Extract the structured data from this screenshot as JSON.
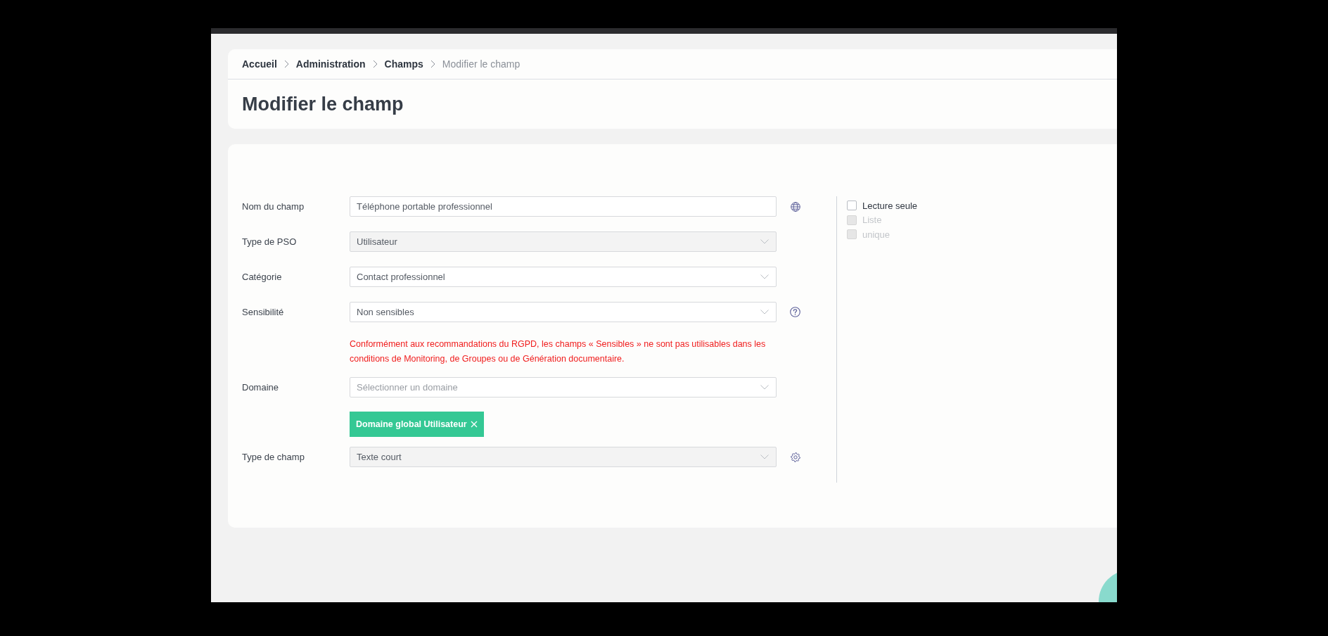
{
  "breadcrumb": [
    {
      "label": "Accueil",
      "current": false
    },
    {
      "label": "Administration",
      "current": false
    },
    {
      "label": "Champs",
      "current": false
    },
    {
      "label": "Modifier le champ",
      "current": true
    }
  ],
  "title": "Modifier le champ",
  "form": {
    "fields": [
      {
        "label": "Nom du champ",
        "kind": "text",
        "value": "Téléphone portable professionnel",
        "disabled": false,
        "side_button": {
          "kind": "translate"
        }
      },
      {
        "label": "Type de PSO",
        "kind": "select",
        "value": "Utilisateur",
        "disabled": true
      },
      {
        "label": "Catégorie",
        "kind": "select",
        "value": "Contact professionnel",
        "disabled": false
      },
      {
        "label": "Sensibilité",
        "kind": "select",
        "value": "Non sensibles",
        "disabled": false,
        "side_button": {
          "kind": "help"
        },
        "note": "Conformément aux recommandations du RGPD, les champs « Sensibles » ne sont pas utilisables dans les conditions de Monitoring, de Groupes ou de Génération documentaire."
      },
      {
        "label": "Domaine",
        "kind": "select",
        "placeholder": "Sélectionner un domaine",
        "disabled": false,
        "tags": [
          {
            "label": "Domaine global Utilisateur"
          }
        ]
      },
      {
        "label": "Type de champ",
        "kind": "select",
        "value": "Texte court",
        "disabled": true,
        "side_button": {
          "kind": "settings"
        }
      }
    ]
  },
  "options": [
    {
      "label": "Lecture seule",
      "checked": false,
      "disabled": false
    },
    {
      "label": "Liste",
      "checked": false,
      "disabled": true
    },
    {
      "label": "unique",
      "checked": false,
      "disabled": true
    }
  ]
}
